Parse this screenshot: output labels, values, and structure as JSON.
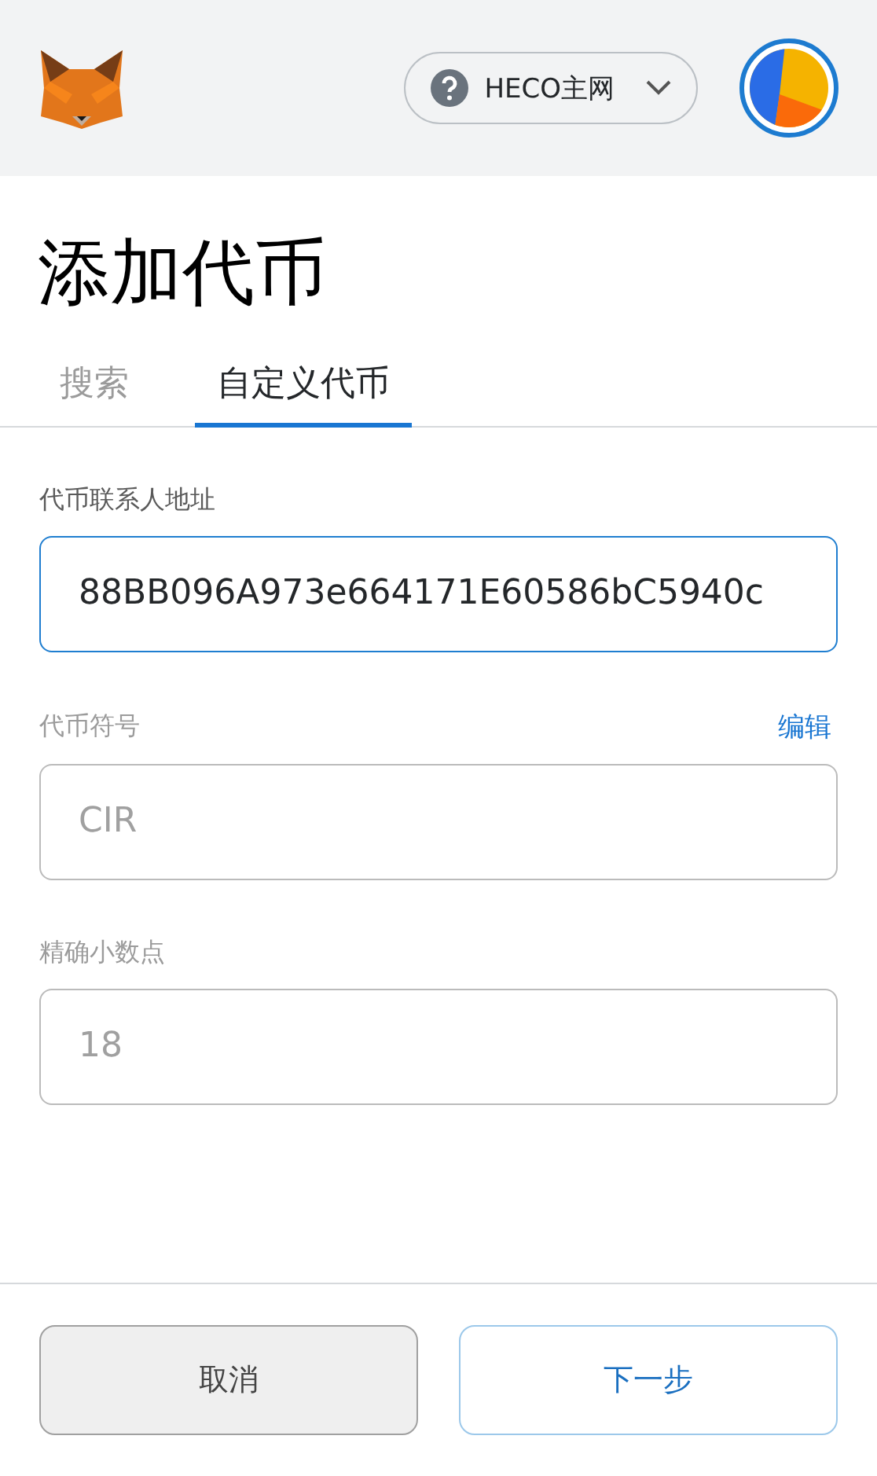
{
  "header": {
    "network": {
      "label": "HECO主网"
    }
  },
  "title": "添加代币",
  "tabs": [
    {
      "label": "搜索",
      "selected": false
    },
    {
      "label": "自定义代币",
      "selected": true
    }
  ],
  "fields": [
    {
      "label": "代币联系人地址",
      "value": "88BB096A973e664171E60586bC5940c",
      "focused": true,
      "disabled": false
    },
    {
      "label": "代币符号",
      "value": "CIR",
      "focused": false,
      "disabled": true,
      "action": "编辑"
    },
    {
      "label": "精确小数点",
      "value": "18",
      "focused": false,
      "disabled": true
    }
  ],
  "buttons": [
    {
      "label": "取消",
      "kind": "secondary"
    },
    {
      "label": "下一步",
      "kind": "primary"
    }
  ]
}
